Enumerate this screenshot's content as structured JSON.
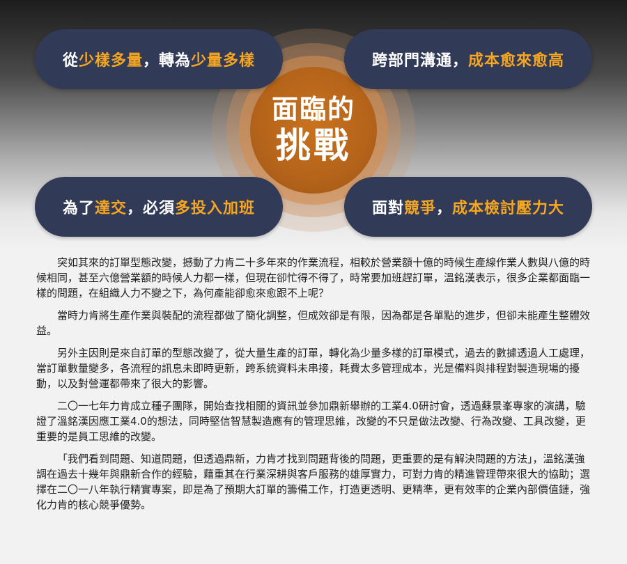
{
  "center": {
    "line1": "面臨的",
    "line2": "挑戰"
  },
  "challenges": [
    {
      "parts": [
        "從",
        "少樣多量",
        "，轉為",
        "少量多樣"
      ]
    },
    {
      "parts": [
        "跨部門溝通，",
        "成本愈來愈高"
      ]
    },
    {
      "parts": [
        "為了",
        "達交",
        "，必須",
        "多投入加班"
      ]
    },
    {
      "parts": [
        "面對",
        "競爭",
        "，",
        "成本檢討壓力大"
      ]
    }
  ],
  "colors": {
    "pill_bg": "#313a56",
    "highlight": "#f5a623",
    "circle_core": "#b4631a"
  },
  "paragraphs": [
    "突如其來的訂單型態改變，撼動了力肯二十多年來的作業流程，相較於營業額十億的時候生產線作業人數與八億的時候相同，甚至六億營業額的時候人力都一樣，但現在卻忙得不得了，時常要加班趕訂單，溫銘漢表示，很多企業都面臨一樣的問題，在組織人力不變之下，為何產能卻愈來愈跟不上呢？",
    "當時力肯將生產作業與裝配的流程都做了簡化調整，但成效卻是有限，因為都是各單點的進步，但卻未能產生整體效益。",
    "另外主因則是來自訂單的型態改變了，從大量生產的訂單，轉化為少量多樣的訂單模式，過去的數據透過人工處理，當訂單數量變多，各流程的訊息未即時更新，跨系統資料未串接，耗費太多管理成本，光是備料與排程對製造現場的擾動，以及對營運都帶來了很大的影響。",
    "二〇一七年力肯成立種子團隊，開始查找相關的資訊並參加鼎新舉辦的工業4.0研討會，透過蘇景峯專家的演講，驗證了溫銘漢因應工業4.0的想法，同時堅信智慧製造應有的管理思維，改變的不只是做法改變、行為改變、工具改變，更重要的是員工思維的改變。",
    "「我們看到問題、知道問題，但透過鼎新，力肯才找到問題背後的問題，更重要的是有解決問題的方法」，溫銘漢強調在過去十幾年與鼎新合作的經驗，藉重其在行業深耕與客戶服務的雄厚實力，可對力肯的精進管理帶來很大的協助；選擇在二〇一八年執行精實專案，即是為了預期大訂單的籌備工作，打造更透明、更精準，更有效率的企業內部價值鏈，強化力肯的核心競爭優勢。"
  ]
}
